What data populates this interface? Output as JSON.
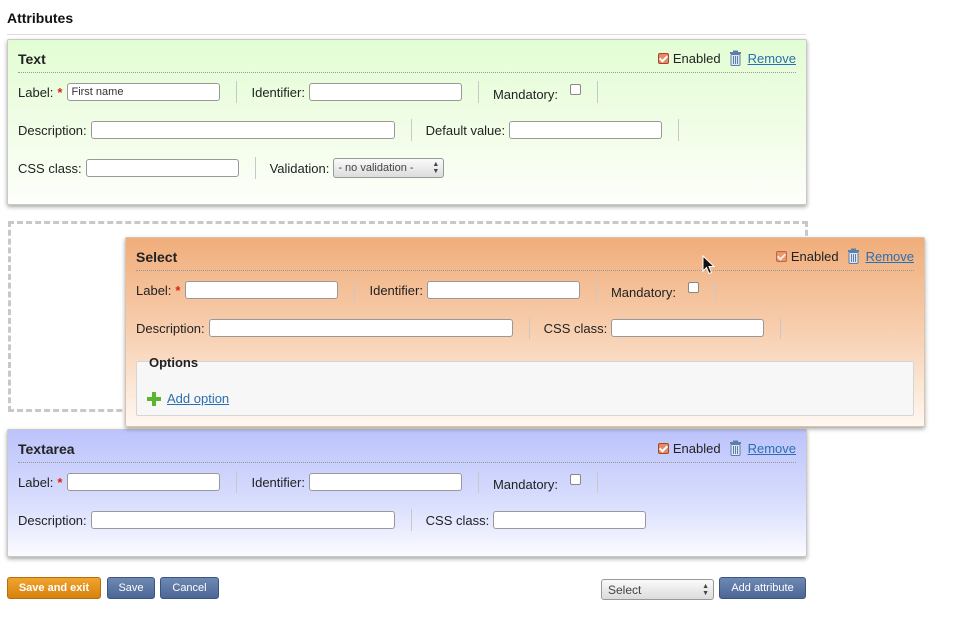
{
  "page": {
    "heading": "Attributes"
  },
  "common": {
    "enabled_label": "Enabled",
    "remove_label": "Remove",
    "required_mark": "*"
  },
  "text_attr": {
    "title": "Text",
    "label_label": "Label:",
    "label_value": "First name",
    "identifier_label": "Identifier:",
    "identifier_value": "",
    "mandatory_label": "Mandatory:",
    "description_label": "Description:",
    "default_value_label": "Default value:",
    "css_class_label": "CSS class:",
    "validation_label": "Validation:",
    "validation_value": "- no validation -",
    "enabled": true,
    "mandatory": false
  },
  "select_attr": {
    "title": "Select",
    "label_label": "Label:",
    "identifier_label": "Identifier:",
    "mandatory_label": "Mandatory:",
    "description_label": "Description:",
    "css_class_label": "CSS class:",
    "options_title": "Options",
    "add_option_label": "Add option",
    "enabled": true,
    "mandatory": false
  },
  "textarea_attr": {
    "title": "Textarea",
    "label_label": "Label:",
    "identifier_label": "Identifier:",
    "mandatory_label": "Mandatory:",
    "description_label": "Description:",
    "css_class_label": "CSS class:",
    "enabled": true,
    "mandatory": false
  },
  "footer": {
    "save_exit_label": "Save and exit",
    "save_label": "Save",
    "cancel_label": "Cancel",
    "type_select_value": "Select",
    "add_attribute_label": "Add attribute"
  },
  "colors": {
    "text_panel": "#e2fdd4",
    "select_panel": "#f0ad7a",
    "textarea_panel": "#bcc3fb",
    "primary_button": "#e8961e",
    "secondary_button": "#5a749f",
    "link": "#2a6fb0"
  },
  "icons": [
    "trash-icon",
    "checkbox-checked-icon",
    "plus-icon",
    "mouse-cursor-icon"
  ]
}
